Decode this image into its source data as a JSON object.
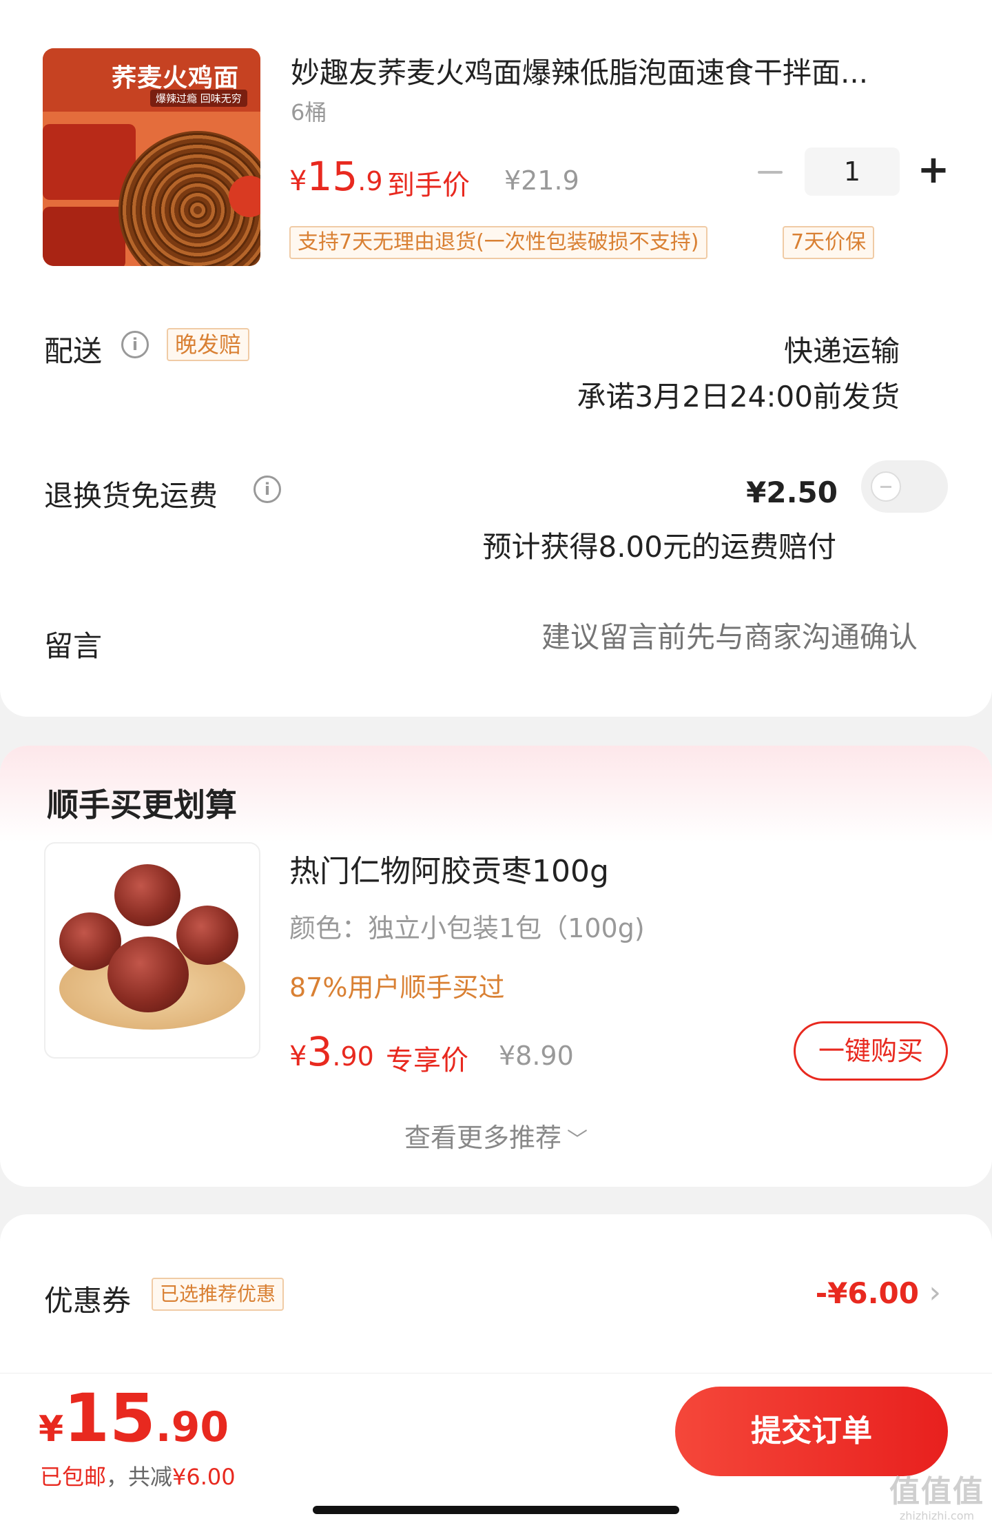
{
  "product": {
    "title": "妙趣友荞麦火鸡面爆辣低脂泡面速食干拌面...",
    "spec": "6桶",
    "image_brand": "荞麦火鸡面",
    "image_slogan": "爆辣过瘾 回味无穷",
    "price_currency": "¥",
    "price_int": "15",
    "price_dec": ".9",
    "price_label": "到手价",
    "original_price": "¥21.9",
    "quantity": "1",
    "minus_label": "−",
    "plus_label": "+",
    "tags": [
      "支持7天无理由退货(一次性包装破损不支持)",
      "7天价保"
    ]
  },
  "shipping": {
    "label": "配送",
    "info_icon": "i",
    "tag": "晚发赔",
    "method": "快递运输",
    "promise": "承诺3月2日24:00前发货"
  },
  "return_insurance": {
    "label": "退换货免运费",
    "info_icon": "i",
    "price": "¥2.50",
    "toggle_on": false,
    "subtitle": "预计获得8.00元的运费赔付"
  },
  "message": {
    "label": "留言",
    "placeholder": "建议留言前先与商家沟通确认"
  },
  "recommendation": {
    "title": "顺手买更划算",
    "product_title": "热门仁物阿胶贡枣100g",
    "spec": "颜色：独立小包装1包（100g)",
    "bought": "87%用户顺手买过",
    "price_currency": "¥",
    "price_int": "3",
    "price_dec": ".90",
    "price_label": "专享价",
    "original_price": "¥8.90",
    "buy_button": "一键购买",
    "more": "查看更多推荐",
    "more_icon": "﹀"
  },
  "coupon": {
    "label": "优惠券",
    "tag": "已选推荐优惠",
    "amount": "-¥6.00",
    "chevron": "›"
  },
  "footer": {
    "price_currency": "¥",
    "price_int": "15",
    "price_dec": ".90",
    "note_free_shipping": "已包邮",
    "note_sep": "，共减",
    "note_discount": "¥6.00",
    "submit": "提交订单"
  },
  "watermark": {
    "big": "值值值",
    "small": "zhizhizhi.com"
  },
  "colors": {
    "accent": "#e8291f",
    "tag_text": "#d98033",
    "tag_border": "#f0cba5"
  }
}
